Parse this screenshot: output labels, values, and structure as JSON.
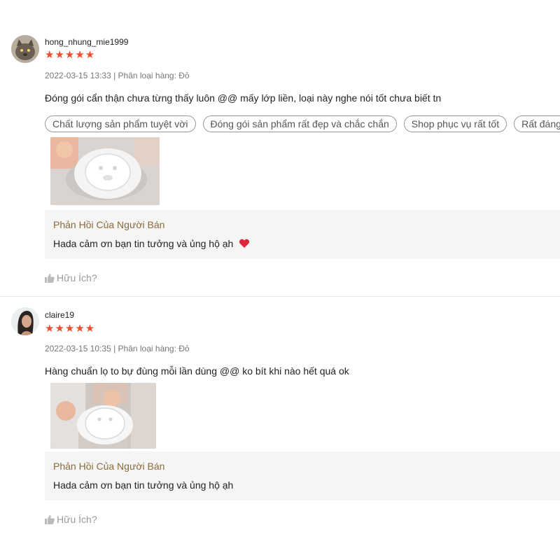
{
  "reviews": [
    {
      "username": "hong_nhung_mie1999",
      "stars": "★★★★★",
      "meta": "2022-03-15 13:33 | Phân loại hàng: Đỏ",
      "comment": "Đóng gói cẩn thận chưa từng thấy luôn @@ mấy lớp liền, loại này nghe nói tốt chưa biết tn",
      "tags": [
        "Chất lượng sản phẩm tuyệt vời",
        "Đóng gói sản phẩm rất đẹp và chắc chắn",
        "Shop phục vụ rất tốt",
        "Rất đáng tiền"
      ],
      "reply_title": "Phản Hồi Của Người Bán",
      "reply_text": "Hada cảm ơn bạn tin tưởng và ủng hộ ạh",
      "helpful": "Hữu Ích?"
    },
    {
      "username": "claire19",
      "stars": "★★★★★",
      "meta": "2022-03-15 10:35 | Phân loại hàng: Đỏ",
      "comment": "Hàng chuẩn lọ to bự đùng mỗi lần dùng @@ ko bít khi nào hết quá ok",
      "reply_title": "Phản Hồi Của Người Bán",
      "reply_text": "Hada cảm ơn bạn tin tưởng và ủng hộ ạh",
      "helpful": "Hữu Ích?"
    }
  ],
  "colors": {
    "star": "#ee4d2d",
    "reply_title": "#8a6a3a",
    "reply_bg": "#f5f5f5"
  }
}
